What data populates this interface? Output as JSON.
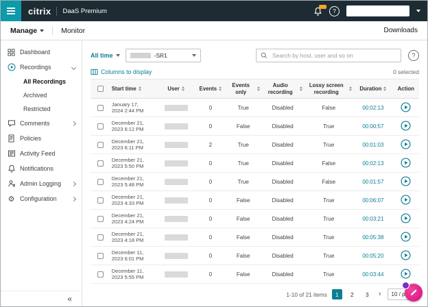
{
  "topbar": {
    "brand": "citrix",
    "product": "DaaS Premium"
  },
  "nav": {
    "manage": "Manage",
    "monitor": "Monitor",
    "downloads": "Downloads"
  },
  "sidebar": {
    "items": [
      {
        "label": "Dashboard"
      },
      {
        "label": "Recordings"
      },
      {
        "label": "Comments"
      },
      {
        "label": "Policies"
      },
      {
        "label": "Activity Feed"
      },
      {
        "label": "Notifications"
      },
      {
        "label": "Admin Logging"
      },
      {
        "label": "Configuration"
      }
    ],
    "recordings_sub": [
      {
        "label": "All Recordings"
      },
      {
        "label": "Archived"
      },
      {
        "label": "Restricted"
      }
    ]
  },
  "filters": {
    "time": "All time",
    "site": "-SR1",
    "search_placeholder": "Search by host, user and so on",
    "columns_link": "Columns to display",
    "selected": "0 selected"
  },
  "table": {
    "columns": [
      "Start time",
      "User",
      "Events",
      "Events only",
      "Audio recording",
      "Lossy screen recording",
      "Duration",
      "Action"
    ],
    "rows": [
      {
        "d1": "January 17,",
        "d2": "2024 2:44 PM",
        "events": "0",
        "events_only": "True",
        "audio": "Disabled",
        "lossy": "False",
        "duration": "00:02:13"
      },
      {
        "d1": "December 21,",
        "d2": "2023 6:12 PM",
        "events": "0",
        "events_only": "False",
        "audio": "Disabled",
        "lossy": "True",
        "duration": "00:00:57"
      },
      {
        "d1": "December 21,",
        "d2": "2023 6:11 PM",
        "events": "2",
        "events_only": "True",
        "audio": "Disabled",
        "lossy": "True",
        "duration": "00:01:03"
      },
      {
        "d1": "December 21,",
        "d2": "2023 5:50 PM",
        "events": "0",
        "events_only": "True",
        "audio": "Disabled",
        "lossy": "False",
        "duration": "00:02:13"
      },
      {
        "d1": "December 21,",
        "d2": "2023 5:48 PM",
        "events": "0",
        "events_only": "True",
        "audio": "Disabled",
        "lossy": "False",
        "duration": "00:01:57"
      },
      {
        "d1": "December 21,",
        "d2": "2023 4:33 PM",
        "events": "0",
        "events_only": "False",
        "audio": "Disabled",
        "lossy": "True",
        "duration": "00:06:07"
      },
      {
        "d1": "December 21,",
        "d2": "2023 4:24 PM",
        "events": "0",
        "events_only": "False",
        "audio": "Disabled",
        "lossy": "True",
        "duration": "00:03:21"
      },
      {
        "d1": "December 21,",
        "d2": "2023 4:18 PM",
        "events": "0",
        "events_only": "False",
        "audio": "Disabled",
        "lossy": "True",
        "duration": "00:05:38"
      },
      {
        "d1": "December 11,",
        "d2": "2023 6:01 PM",
        "events": "0",
        "events_only": "False",
        "audio": "Disabled",
        "lossy": "True",
        "duration": "00:05:20"
      },
      {
        "d1": "December 11,",
        "d2": "2023 5:55 PM",
        "events": "0",
        "events_only": "False",
        "audio": "Disabled",
        "lossy": "True",
        "duration": "00:03:44"
      }
    ]
  },
  "pagination": {
    "summary": "1-10 of 21 items",
    "pages": [
      "1",
      "2",
      "3"
    ],
    "current": "1",
    "page_size": "10 / pa"
  },
  "icons": {
    "help": "?",
    "collapse": "«",
    "next_page": "›",
    "gear": "⚙"
  },
  "colors": {
    "accent_teal": "#0b7e91",
    "topbar_dark": "#1d2b33",
    "menu_teal": "#0d9aaa",
    "badge_orange": "#f5a623",
    "assistant_pink": "#d40e7f"
  }
}
